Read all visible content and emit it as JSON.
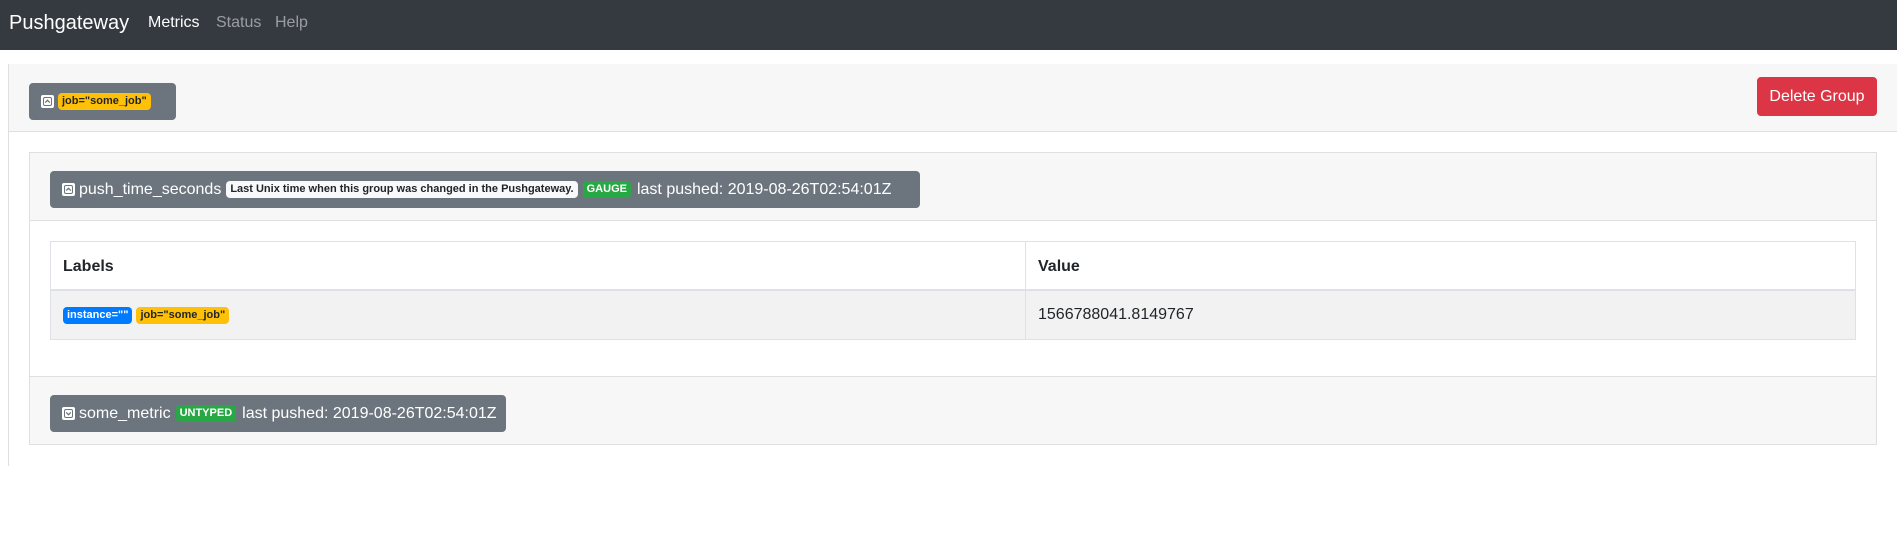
{
  "navbar": {
    "brand": "Pushgateway",
    "links": [
      {
        "label": "Metrics",
        "active": true
      },
      {
        "label": "Status",
        "active": false
      },
      {
        "label": "Help",
        "active": false
      }
    ]
  },
  "group": {
    "label_badge": "job=\"some_job\"",
    "delete_label": "Delete Group"
  },
  "metrics": [
    {
      "name": "push_time_seconds",
      "help": "Last Unix time when this group was changed in the Pushgateway.",
      "type": "GAUGE",
      "last_pushed": "last pushed: 2019-08-26T02:54:01Z",
      "table": {
        "headers": [
          "Labels",
          "Value"
        ],
        "rows": [
          {
            "labels": [
              "instance=\"\"",
              "job=\"some_job\""
            ],
            "value": "1566788041.8149767"
          }
        ]
      }
    },
    {
      "name": "some_metric",
      "type": "UNTYPED",
      "last_pushed": "last pushed: 2019-08-26T02:54:01Z"
    }
  ],
  "colors": {
    "navbar": "#343a40",
    "secondary": "#6c757d",
    "danger": "#dc3545",
    "warning": "#ffc107",
    "success": "#28a745",
    "primary": "#007bff"
  },
  "icons": {
    "collapse": "minus-square-icon",
    "expand": "plus-square-icon"
  }
}
